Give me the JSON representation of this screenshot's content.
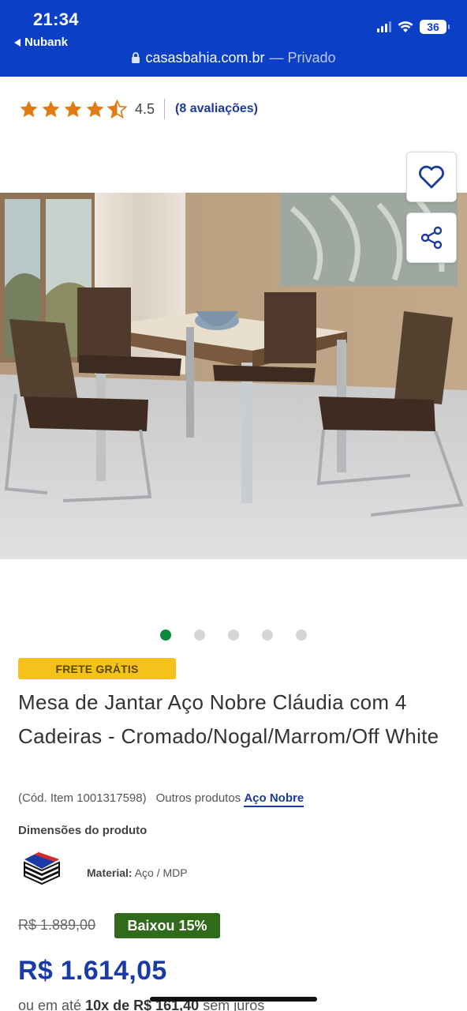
{
  "status_bar": {
    "time": "21:34",
    "back_app": "Nubank",
    "battery": "36"
  },
  "browser": {
    "domain": "casasbahia.com.br",
    "mode": "— Privado"
  },
  "rating": {
    "value": "4.5",
    "stars": 4.5,
    "reviews_link": "(8 avaliações)"
  },
  "gallery": {
    "image_count": 5,
    "active_index": 0,
    "actions": [
      "heart-icon",
      "share-icon"
    ]
  },
  "product": {
    "shipping_badge": "FRETE GRÁTIS",
    "title": "Mesa de Jantar Aço Nobre Cláudia com 4 Cadeiras - Cromado/Nogal/Marrom/Off White",
    "code": "(Cód. Item 1001317598)",
    "other_products_label": "Outros produtos",
    "brand": "Aço Nobre",
    "dimensions_title": "Dimensões do produto",
    "material_label": "Material:",
    "material_value": "Aço / MDP"
  },
  "pricing": {
    "old_price": "R$ 1.889,00",
    "discount_badge": "Baixou 15%",
    "price": "R$ 1.614,05",
    "installments_prefix": "ou em até",
    "installments_bold": "10x de R$ 161,40",
    "installments_suffix": "sem juros"
  },
  "colors": {
    "brand_blue": "#0b3fc6",
    "link_blue": "#1a3a9e",
    "star_orange": "#e07a12",
    "active_dot": "#0a8a3c",
    "free_shipping_yellow": "#f6c21a",
    "discount_green": "#2f6b1a"
  }
}
